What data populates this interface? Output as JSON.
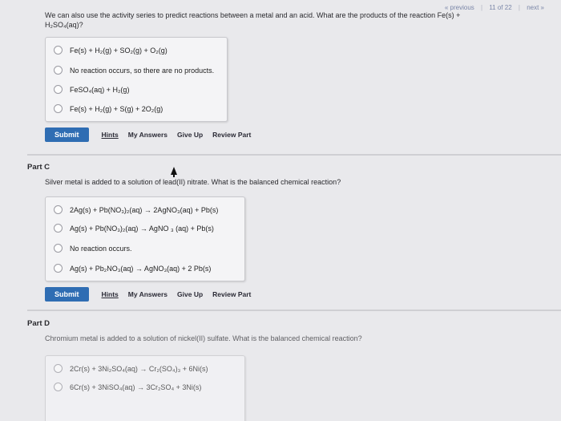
{
  "nav": {
    "previous": "« previous",
    "counter": "11 of 22",
    "next": "next »"
  },
  "partB": {
    "question_line1": "We can also use the activity series to predict reactions between a metal and an acid. What are the products of the reaction Fe(s) +",
    "question_line2": "H₂SO₄(aq)?",
    "choices": [
      "Fe(s) + H₂(g) + SO₂(g) + O₂(g)",
      "No reaction occurs, so there are no products.",
      "FeSO₄(aq) + H₂(g)",
      "Fe(s) + H₂(g) + S(g) + 2O₂(g)"
    ]
  },
  "actions": {
    "submit": "Submit",
    "hints": "Hints",
    "my_answers": "My Answers",
    "give_up": "Give Up",
    "review_part": "Review Part"
  },
  "partC": {
    "title": "Part C",
    "question": "Silver metal is added to a solution of lead(II) nitrate. What is the balanced chemical reaction?",
    "choices": [
      "2Ag(s) + Pb(NO₃)₂(aq) → 2AgNO₃(aq) + Pb(s)",
      "Ag(s) + Pb(NO₃)₂(aq) → AgNO ₃ (aq) + Pb(s)",
      "No reaction occurs.",
      "Ag(s) + Pb₂NO₃(aq) → AgNO₃(aq) + 2 Pb(s)"
    ]
  },
  "partD": {
    "title": "Part D",
    "question": "Chromium metal is added to a solution of nickel(II) sulfate. What is the balanced chemical reaction?",
    "choices": [
      "2Cr(s) + 3Ni₂SO₄(aq) → Cr₂(SO₄)₃ + 6Ni(s)",
      "6Cr(s) + 3NiSO₄(aq) → 3Cr₂SO₄ + 3Ni(s)"
    ]
  },
  "colors": {
    "submit_bg": "#2f6db3",
    "nav_link": "#7a86a8"
  }
}
